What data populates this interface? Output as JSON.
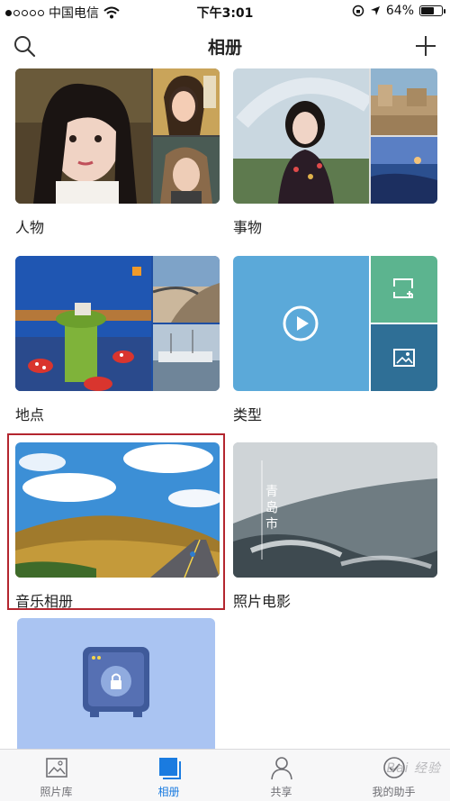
{
  "status_bar": {
    "carrier": "中国电信",
    "time": "下午3:01",
    "battery": "64%",
    "battery_level": 0.64
  },
  "nav": {
    "title": "相册",
    "left_icon": "search-icon",
    "right_icon": "plus-icon"
  },
  "albums": [
    {
      "label": "人物"
    },
    {
      "label": "事物"
    },
    {
      "label": "地点"
    },
    {
      "label": "类型"
    },
    {
      "label": "音乐相册"
    },
    {
      "label": "照片电影",
      "cover_text": "青岛市"
    },
    {
      "label": "",
      "icon": "safe-lock-icon"
    }
  ],
  "tabs": [
    {
      "label": "照片库",
      "icon": "photo-icon",
      "active": false
    },
    {
      "label": "相册",
      "icon": "album-icon",
      "active": true
    },
    {
      "label": "共享",
      "icon": "person-icon",
      "active": false
    },
    {
      "label": "我的助手",
      "icon": "assistant-icon",
      "active": false
    }
  ],
  "watermark": "Bai 经验",
  "colors": {
    "accent": "#1a7be0",
    "highlight": "#b3262f",
    "type_blue": "#5ba9d9",
    "type_green": "#5cb48f",
    "type_dark": "#2f6f96",
    "safe_bg": "#aac4f2"
  }
}
